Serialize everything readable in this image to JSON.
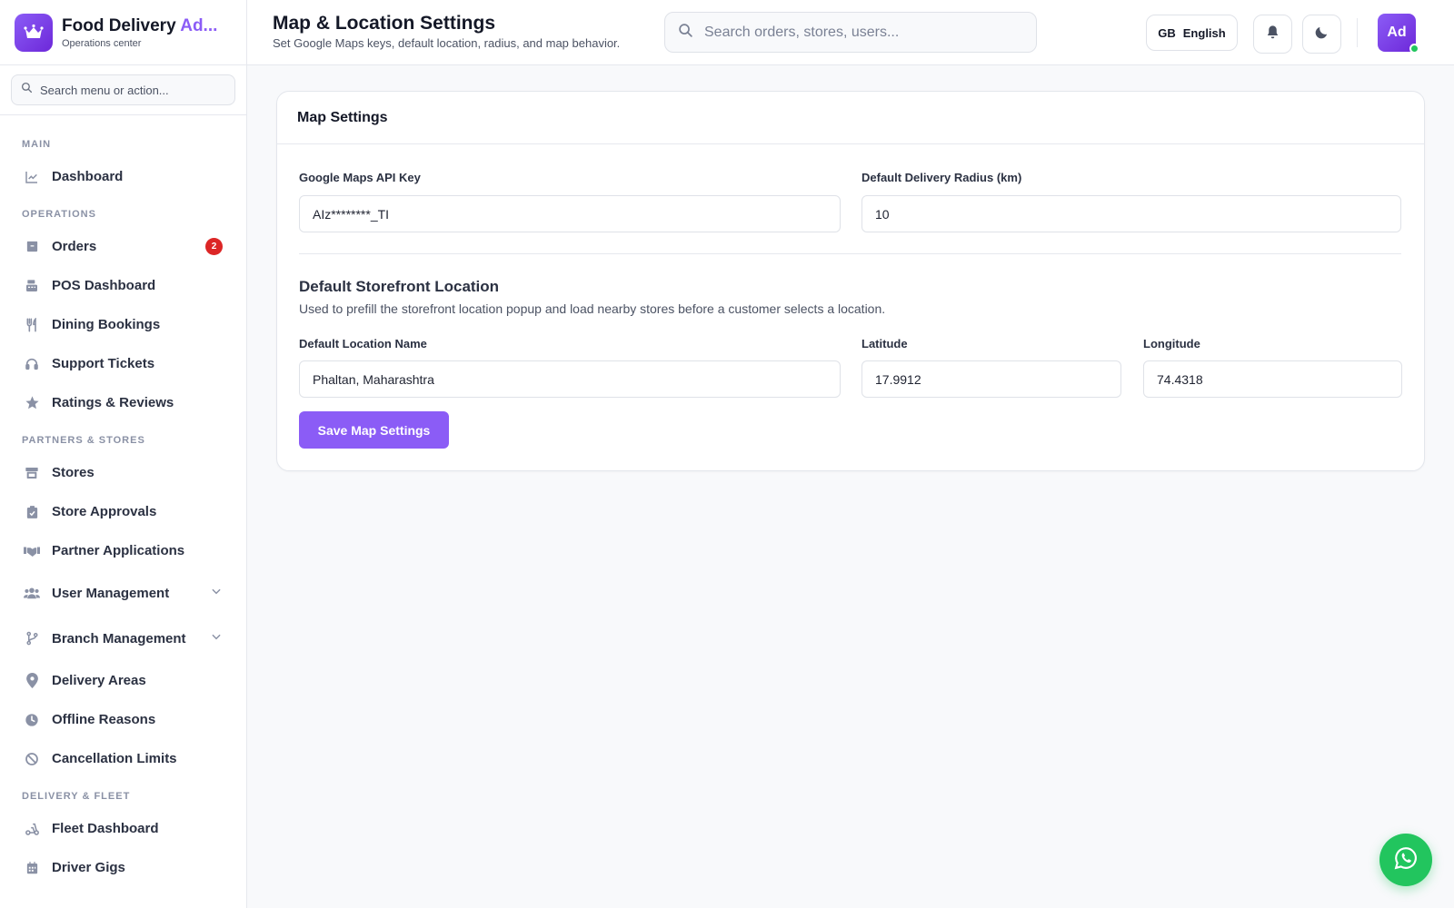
{
  "brand": {
    "title_main": "Food Delivery ",
    "title_accent": "Ad...",
    "subtitle": "Operations center"
  },
  "sidebar": {
    "search_placeholder": "Search menu or action...",
    "sections": {
      "main": "MAIN",
      "operations": "OPERATIONS",
      "partners": "PARTNERS & STORES",
      "fleet": "DELIVERY & FLEET"
    },
    "items": {
      "dashboard": "Dashboard",
      "orders": "Orders",
      "orders_badge": "2",
      "pos": "POS Dashboard",
      "dining": "Dining Bookings",
      "support": "Support Tickets",
      "ratings": "Ratings & Reviews",
      "stores": "Stores",
      "store_approvals": "Store Approvals",
      "partner_apps": "Partner Applications",
      "user_mgmt": "User Management",
      "branch_mgmt": "Branch Management",
      "delivery_areas": "Delivery Areas",
      "offline_reasons": "Offline Reasons",
      "cancel_limits": "Cancellation Limits",
      "fleet_dashboard": "Fleet Dashboard",
      "driver_gigs": "Driver Gigs"
    }
  },
  "header": {
    "title": "Map & Location Settings",
    "subtitle": "Set Google Maps keys, default location, radius, and map behavior.",
    "search_placeholder": "Search orders, stores, users...",
    "lang_code": "GB",
    "lang_label": "English",
    "avatar_initials": "Ad"
  },
  "card": {
    "title": "Map Settings",
    "api_key_label": "Google Maps API Key",
    "api_key_value": "AIz********_TI",
    "radius_label": "Default Delivery Radius (km)",
    "radius_value": "10",
    "section_title": "Default Storefront Location",
    "section_desc": "Used to prefill the storefront location popup and load nearby stores before a customer selects a location.",
    "loc_name_label": "Default Location Name",
    "loc_name_value": "Phaltan, Maharashtra",
    "lat_label": "Latitude",
    "lat_value": "17.9912",
    "lng_label": "Longitude",
    "lng_value": "74.4318",
    "save_label": "Save Map Settings"
  },
  "colors": {
    "accent": "#8b5cf6",
    "badge": "#dc2626",
    "whatsapp": "#22c55e"
  },
  "icons": [
    "crown-icon",
    "search-icon",
    "chart-icon",
    "box-icon",
    "register-icon",
    "utensils-icon",
    "headset-icon",
    "star-icon",
    "store-icon",
    "clipboard-check-icon",
    "handshake-icon",
    "users-icon",
    "branch-icon",
    "map-pin-icon",
    "clock-icon",
    "ban-icon",
    "scooter-icon",
    "calendar-icon",
    "bell-icon",
    "moon-icon",
    "whatsapp-icon",
    "chevron-down-icon"
  ]
}
